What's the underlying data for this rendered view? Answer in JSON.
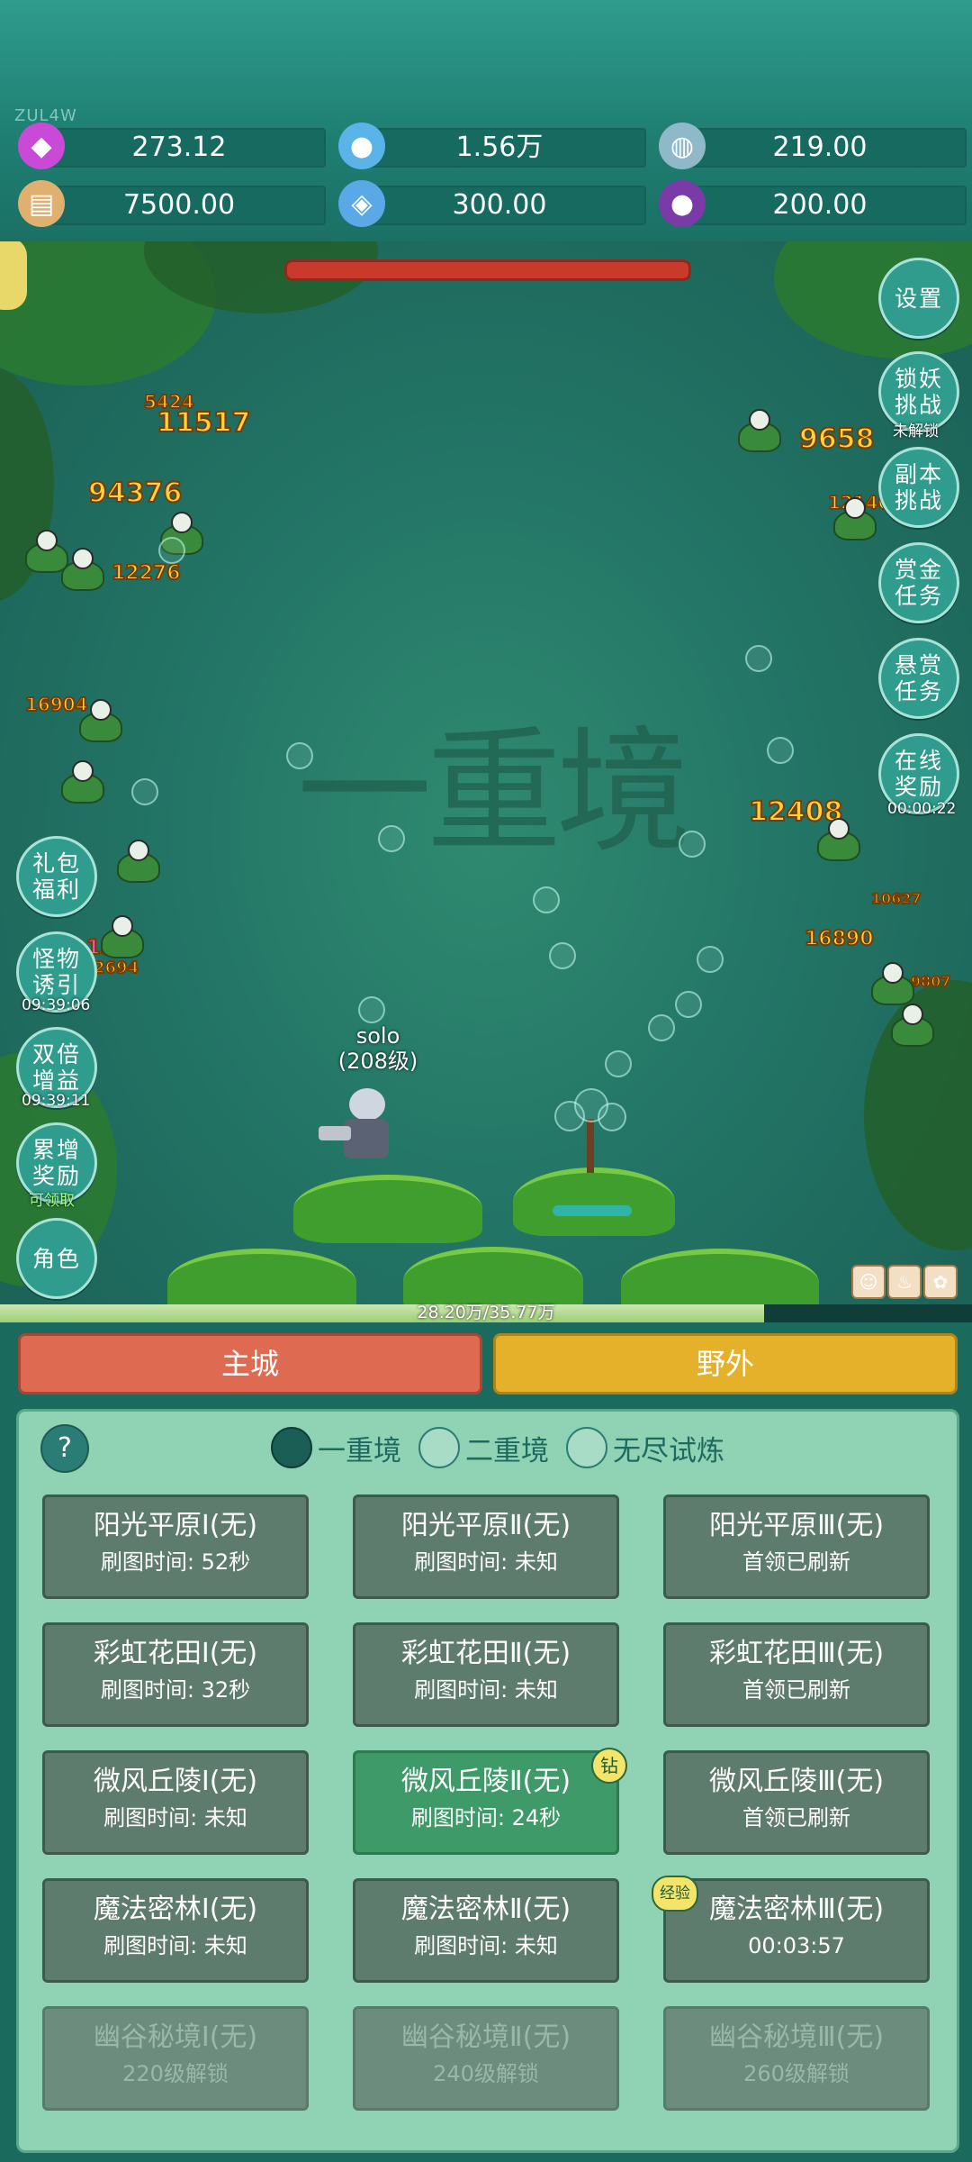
{
  "top": {
    "tag": "ZUL4W",
    "resources": [
      {
        "icon": "gem-icon",
        "value": "273.12",
        "color": "#c84ad6"
      },
      {
        "icon": "crystal-ball-icon",
        "value": "1.56万",
        "color": "#5ab4e8"
      },
      {
        "icon": "planet-icon",
        "value": "219.00",
        "color": "#8fb8c8"
      },
      {
        "icon": "book-icon",
        "value": "7500.00",
        "color": "#e0b070"
      },
      {
        "icon": "diamond-icon",
        "value": "300.00",
        "color": "#5aa8e8"
      },
      {
        "icon": "purple-orb-icon",
        "value": "200.00",
        "color": "#7a3aa8"
      }
    ]
  },
  "game": {
    "watermark": "一重境",
    "damage_numbers": [
      "5424",
      "11517",
      "94376",
      "12276",
      "16904",
      "9658",
      "12140",
      "12408",
      "10627",
      "16890",
      "9807",
      "15",
      "2694"
    ],
    "player": {
      "name": "solo",
      "level": "(208级)"
    },
    "right_buttons": [
      {
        "label": "设置",
        "sub": ""
      },
      {
        "label": "锁妖挑战",
        "sub": "未解锁"
      },
      {
        "label": "副本挑战",
        "sub": ""
      },
      {
        "label": "赏金任务",
        "sub": ""
      },
      {
        "label": "悬赏任务",
        "sub": ""
      },
      {
        "label": "在线奖励",
        "sub": "00:00:22"
      }
    ],
    "left_buttons": [
      {
        "label": "礼包福利",
        "sub": ""
      },
      {
        "label": "怪物诱引",
        "sub": "09:39:06"
      },
      {
        "label": "双倍增益",
        "sub": "09:39:11"
      },
      {
        "label": "累增奖励",
        "sub": "可领取"
      },
      {
        "label": "角色",
        "sub": ""
      }
    ]
  },
  "xp": {
    "text": "28.20万/35.77万",
    "fraction": 0.786
  },
  "tabs": {
    "city": "主城",
    "wild": "野外"
  },
  "panel": {
    "help": "?",
    "realms": [
      {
        "label": "一重境",
        "selected": true
      },
      {
        "label": "二重境",
        "selected": false
      },
      {
        "label": "无尽试炼",
        "selected": false
      }
    ],
    "maps": [
      {
        "name": "阳光平原Ⅰ(无)",
        "sub": "刷图时间: 52秒"
      },
      {
        "name": "阳光平原Ⅱ(无)",
        "sub": "刷图时间: 未知"
      },
      {
        "name": "阳光平原Ⅲ(无)",
        "sub": "首领已刷新"
      },
      {
        "name": "彩虹花田Ⅰ(无)",
        "sub": "刷图时间: 32秒"
      },
      {
        "name": "彩虹花田Ⅱ(无)",
        "sub": "刷图时间: 未知"
      },
      {
        "name": "彩虹花田Ⅲ(无)",
        "sub": "首领已刷新"
      },
      {
        "name": "微风丘陵Ⅰ(无)",
        "sub": "刷图时间: 未知"
      },
      {
        "name": "微风丘陵Ⅱ(无)",
        "sub": "刷图时间: 24秒",
        "badge": "钻"
      },
      {
        "name": "微风丘陵Ⅲ(无)",
        "sub": "首领已刷新"
      },
      {
        "name": "魔法密林Ⅰ(无)",
        "sub": "刷图时间: 未知"
      },
      {
        "name": "魔法密林Ⅱ(无)",
        "sub": "刷图时间: 未知"
      },
      {
        "name": "魔法密林Ⅲ(无)",
        "sub": "00:03:57",
        "badge": "经验"
      },
      {
        "name": "幽谷秘境Ⅰ(无)",
        "sub": "220级解锁"
      },
      {
        "name": "幽谷秘境Ⅱ(无)",
        "sub": "240级解锁"
      },
      {
        "name": "幽谷秘境Ⅲ(无)",
        "sub": "260级解锁"
      }
    ]
  }
}
